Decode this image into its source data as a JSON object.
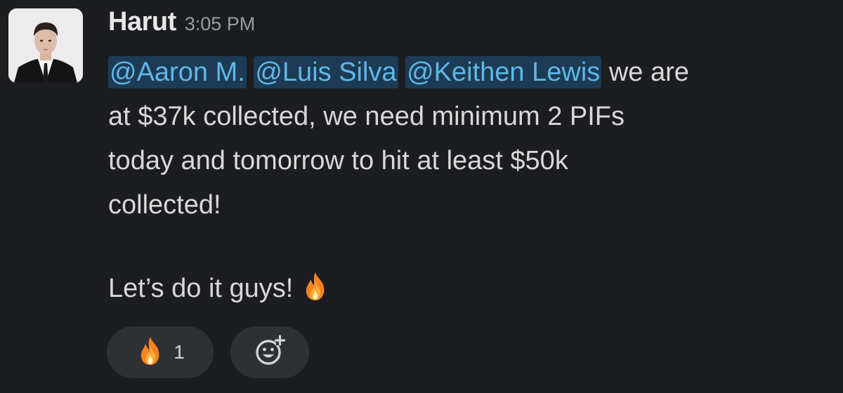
{
  "message": {
    "author": "Harut",
    "timestamp": "3:05 PM",
    "lines": [
      {
        "mentions": [
          "@Aaron M.",
          "@Luis Silva",
          "@Keithen Lewis"
        ],
        "trailing": "we are"
      },
      {
        "text": "at $37k collected, we need minimum 2 PIFs"
      },
      {
        "text": "today and tomorrow to hit at least $50k"
      },
      {
        "text": "collected!"
      },
      {
        "text": ""
      },
      {
        "text": "Let’s do it guys!",
        "emoji": "fire-icon"
      }
    ],
    "reactions": [
      {
        "emoji": "fire-icon",
        "count": "1"
      }
    ],
    "add_reaction_icon": "add-reaction-icon"
  },
  "colors": {
    "background": "#1b1d21",
    "mention_bg": "#1d3b54",
    "mention_text": "#5fb7e8",
    "pill_bg": "#2e3034"
  }
}
